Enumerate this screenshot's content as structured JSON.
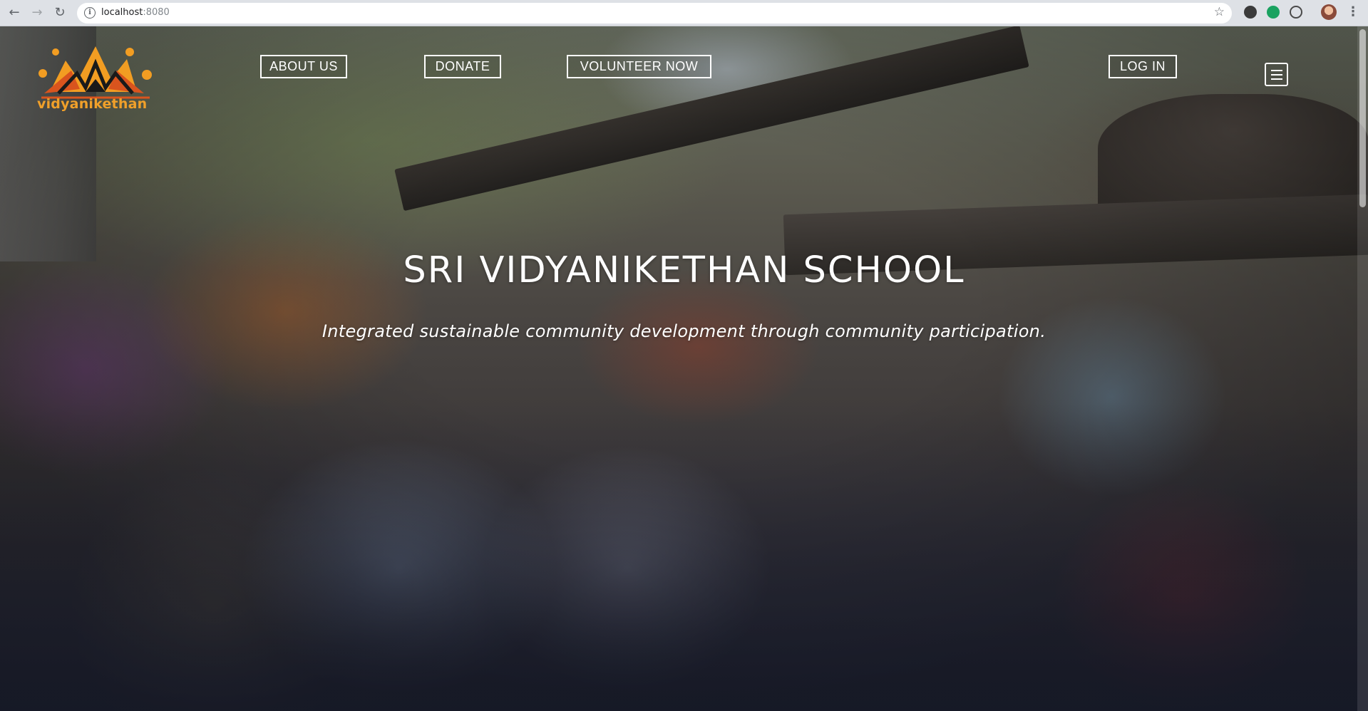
{
  "browser": {
    "url_host": "localhost",
    "url_port": ":8080",
    "icons": [
      "back-icon",
      "forward-icon",
      "reload-icon",
      "info-icon",
      "star-icon",
      "menu-icon"
    ]
  },
  "site": {
    "logo_text": "vidyanikethan",
    "nav": {
      "about": "ABOUT US",
      "donate": "DONATE",
      "volunteer": "VOLUNTEER NOW",
      "login": "LOG IN"
    },
    "hero": {
      "title": "SRI VIDYANIKETHAN SCHOOL",
      "subtitle": "Integrated sustainable community development through community participation."
    }
  },
  "colors": {
    "logo_orange": "#f29d22",
    "logo_red": "#d9541e",
    "nav_border": "#ffffff",
    "text": "#ffffff"
  }
}
